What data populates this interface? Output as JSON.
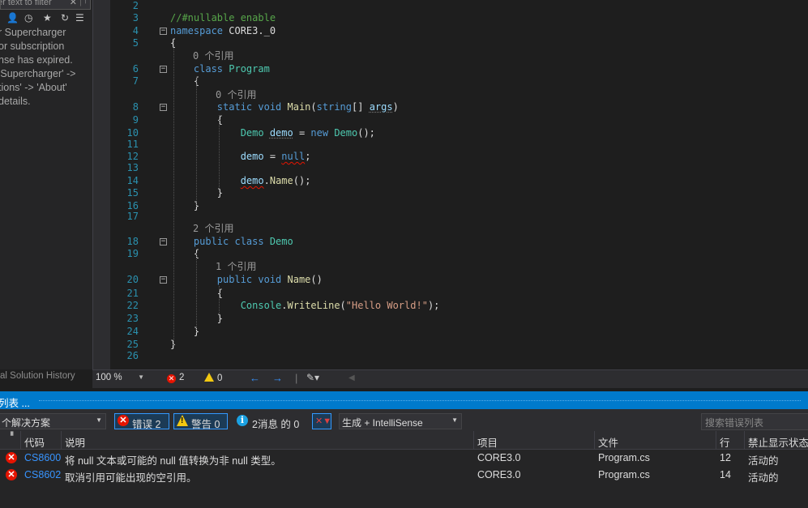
{
  "left_panel": {
    "filter_placeholder": "er text to filter",
    "message_lines": [
      "r Supercharger",
      " or subscription",
      "nse has expired.",
      " 'Supercharger' ->",
      "tions' -> 'About'",
      "details."
    ],
    "bottom_status": "al Solution History"
  },
  "editor": {
    "lines": [
      {
        "n": "2",
        "tokens": []
      },
      {
        "n": "3",
        "tokens": [
          {
            "t": "//#nullable enable",
            "c": "cm"
          }
        ]
      },
      {
        "n": "4",
        "fold": true,
        "tokens": [
          {
            "t": "namespace ",
            "c": "kw"
          },
          {
            "t": "CORE3._0",
            "c": "pu"
          }
        ]
      },
      {
        "n": "5",
        "tokens": [
          {
            "t": "{",
            "c": "pu"
          }
        ]
      },
      {
        "n": "",
        "ref": "0 个引用"
      },
      {
        "n": "6",
        "fold": true,
        "tokens": [
          {
            "t": "    class ",
            "c": "kw"
          },
          {
            "t": "Program",
            "c": "ty"
          }
        ]
      },
      {
        "n": "7",
        "tokens": [
          {
            "t": "    {",
            "c": "pu"
          }
        ]
      },
      {
        "n": "",
        "ref": "0 个引用"
      },
      {
        "n": "8",
        "fold": true,
        "tokens": [
          {
            "t": "        static void ",
            "c": "kw"
          },
          {
            "t": "Main",
            "c": "fn"
          },
          {
            "t": "(",
            "c": "pu"
          },
          {
            "t": "string",
            "c": "kw"
          },
          {
            "t": "[] ",
            "c": "pu"
          },
          {
            "t": "args",
            "c": "pa",
            "u": "squigg"
          },
          {
            "t": ")",
            "c": "pu"
          }
        ]
      },
      {
        "n": "9",
        "tokens": [
          {
            "t": "        {",
            "c": "pu"
          }
        ]
      },
      {
        "n": "10",
        "tokens": [
          {
            "t": "            Demo ",
            "c": "ty"
          },
          {
            "t": "demo",
            "c": "pa",
            "u": "squigg"
          },
          {
            "t": " = ",
            "c": "pu"
          },
          {
            "t": "new ",
            "c": "kw"
          },
          {
            "t": "Demo",
            "c": "ty"
          },
          {
            "t": "();",
            "c": "pu"
          }
        ]
      },
      {
        "n": "11",
        "tokens": []
      },
      {
        "n": "12",
        "tokens": [
          {
            "t": "            demo",
            "c": "pa"
          },
          {
            "t": " = ",
            "c": "pu"
          },
          {
            "t": "null",
            "c": "kw",
            "u": "squig"
          },
          {
            "t": ";",
            "c": "pu"
          }
        ]
      },
      {
        "n": "13",
        "tokens": []
      },
      {
        "n": "14",
        "tokens": [
          {
            "t": "            ",
            "c": "pu"
          },
          {
            "t": "demo",
            "c": "pa",
            "u": "squig"
          },
          {
            "t": ".",
            "c": "pu"
          },
          {
            "t": "Name",
            "c": "fn"
          },
          {
            "t": "();",
            "c": "pu"
          }
        ]
      },
      {
        "n": "15",
        "tokens": [
          {
            "t": "        }",
            "c": "pu"
          }
        ]
      },
      {
        "n": "16",
        "tokens": [
          {
            "t": "    }",
            "c": "pu"
          }
        ]
      },
      {
        "n": "17",
        "tokens": []
      },
      {
        "n": "",
        "ref": "2 个引用"
      },
      {
        "n": "18",
        "fold": true,
        "tokens": [
          {
            "t": "    public class ",
            "c": "kw"
          },
          {
            "t": "Demo",
            "c": "ty"
          }
        ]
      },
      {
        "n": "19",
        "tokens": [
          {
            "t": "    {",
            "c": "pu"
          }
        ]
      },
      {
        "n": "",
        "ref": "1 个引用"
      },
      {
        "n": "20",
        "fold": true,
        "tokens": [
          {
            "t": "        public void ",
            "c": "kw"
          },
          {
            "t": "Name",
            "c": "fn"
          },
          {
            "t": "()",
            "c": "pu"
          }
        ]
      },
      {
        "n": "21",
        "tokens": [
          {
            "t": "        {",
            "c": "pu"
          }
        ]
      },
      {
        "n": "22",
        "tokens": [
          {
            "t": "            Console",
            "c": "ty"
          },
          {
            "t": ".",
            "c": "pu"
          },
          {
            "t": "WriteLine",
            "c": "fn"
          },
          {
            "t": "(",
            "c": "pu"
          },
          {
            "t": "\"Hello World!\"",
            "c": "st"
          },
          {
            "t": ");",
            "c": "pu"
          }
        ]
      },
      {
        "n": "23",
        "tokens": [
          {
            "t": "        }",
            "c": "pu"
          }
        ]
      },
      {
        "n": "24",
        "tokens": [
          {
            "t": "    }",
            "c": "pu"
          }
        ]
      },
      {
        "n": "25",
        "tokens": [
          {
            "t": "}",
            "c": "pu"
          }
        ]
      },
      {
        "n": "26",
        "tokens": []
      }
    ]
  },
  "status_strip": {
    "zoom": "100 %",
    "errors": "2",
    "warnings": "0"
  },
  "error_list": {
    "title": "列表 ...",
    "scope": "个解决方案",
    "errors_label": "错误 2",
    "warnings_label": "警告 0",
    "messages_label": "2消息 的 0",
    "build_filter": "生成 + IntelliSense",
    "search_placeholder": "搜索错误列表",
    "columns": {
      "code": "代码",
      "description": "说明",
      "project": "项目",
      "file": "文件",
      "line": "行",
      "suppression": "禁止显示状态"
    },
    "rows": [
      {
        "code": "CS8600",
        "description": "将 null 文本或可能的 null 值转换为非 null 类型。",
        "project": "CORE3.0",
        "file": "Program.cs",
        "line": "12",
        "suppression": "活动的"
      },
      {
        "code": "CS8602",
        "description": "取消引用可能出现的空引用。",
        "project": "CORE3.0",
        "file": "Program.cs",
        "line": "14",
        "suppression": "活动的"
      }
    ]
  },
  "colors": {
    "accent": "#007acc",
    "error": "#e51400",
    "warning": "#f2c811",
    "info": "#1ba1e2"
  }
}
